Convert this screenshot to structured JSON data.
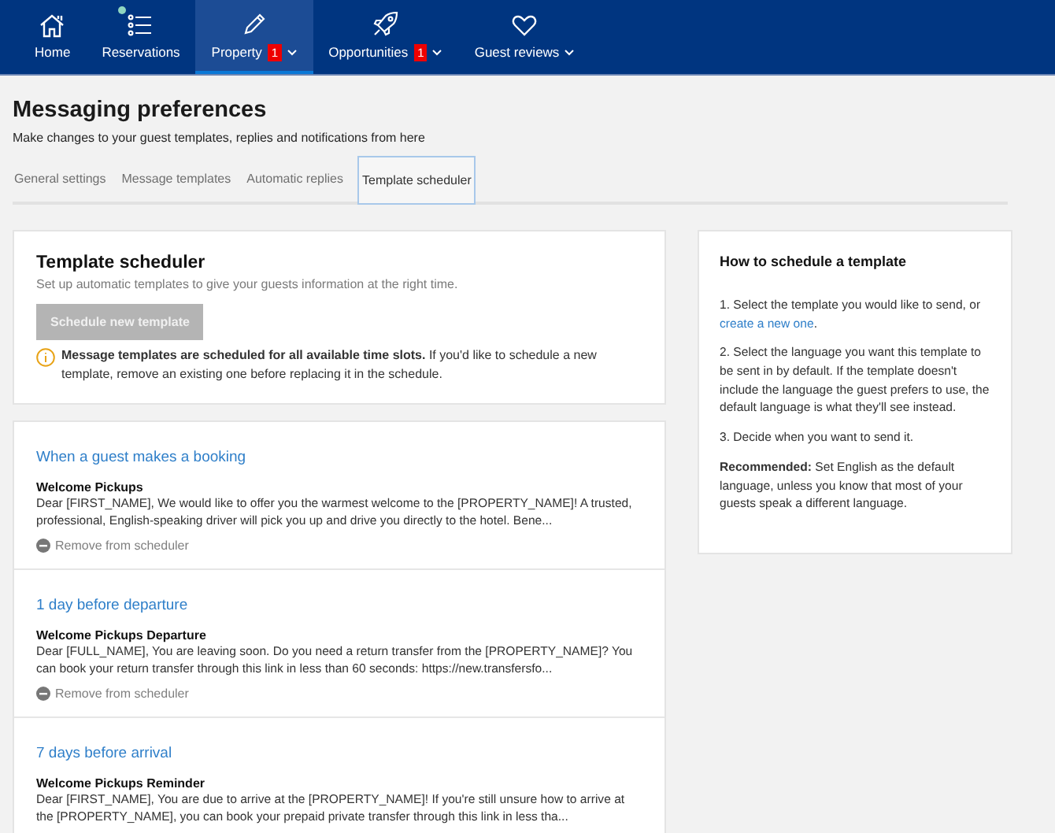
{
  "nav": [
    {
      "label": "Home",
      "kind": "home",
      "selected": false,
      "dropdown": false,
      "dot": false
    },
    {
      "label": "Reservations",
      "kind": "list",
      "selected": false,
      "dropdown": false,
      "dot": true
    },
    {
      "label": "Property",
      "kind": "pencil",
      "selected": true,
      "badge": "1",
      "dropdown": true,
      "dot": false
    },
    {
      "label": "Opportunities",
      "kind": "rocket",
      "selected": false,
      "badge": "1",
      "dropdown": true,
      "dot": false
    },
    {
      "label": "Guest reviews",
      "kind": "heart",
      "selected": false,
      "dropdown": true,
      "dot": false
    }
  ],
  "page": {
    "title": "Messaging preferences",
    "subtitle": "Make changes to your guest templates, replies and notifications from here"
  },
  "tabs": [
    {
      "label": "General settings",
      "selected": false
    },
    {
      "label": "Message templates",
      "selected": false
    },
    {
      "label": "Automatic replies",
      "selected": false
    },
    {
      "label": "Template scheduler",
      "selected": true
    }
  ],
  "scheduler": {
    "title": "Template scheduler",
    "subtitle": "Set up automatic templates to give your guests information at the right time.",
    "button": {
      "label": "Schedule new template",
      "disabled": true
    },
    "notice": "**Message templates are scheduled for all available time slots.** If you'd like to schedule a new template, remove an existing one before replacing it in the schedule."
  },
  "scheduled": [
    {
      "trigger": "When a guest makes a booking",
      "name": "Welcome Pickups",
      "preview": "Dear [FIRST_NAME], We would like to offer you the warmest welcome to the [PROPERTY_NAME]! A trusted, professional, English-speaking driver will pick you up and drive you directly to the hotel. Bene...",
      "remove": "Remove from scheduler"
    },
    {
      "trigger": "1 day before departure",
      "name": "Welcome Pickups Departure",
      "preview": "Dear [FULL_NAME], You are leaving soon. Do you need a return transfer from the [PROPERTY_NAME]? You can book your return transfer through this link in less than 60 seconds: https://new.transfersfo...",
      "remove": "Remove from scheduler"
    },
    {
      "trigger": "7 days before arrival",
      "name": "Welcome Pickups Reminder",
      "preview": "Dear [FIRST_NAME], You are due to arrive at the [PROPERTY_NAME]! If you're still unsure how to arrive at the [PROPERTY_NAME], you can book your prepaid private transfer through this link in less tha..."
    }
  ],
  "help": {
    "title": "How to schedule a template",
    "step1": "1. Select the template you would like to send, or",
    "step1_link": "create a new one",
    "step1_end": ".",
    "steps": [
      "2. Select the language you want this template to be sent in by default. If the template doesn't include the language the guest prefers to use, the default language is what they'll see instead.",
      "3. Decide when you want to send it.",
      "**Recommended:** Set English as the default language, unless you know that most of your guests speak a different language."
    ]
  }
}
